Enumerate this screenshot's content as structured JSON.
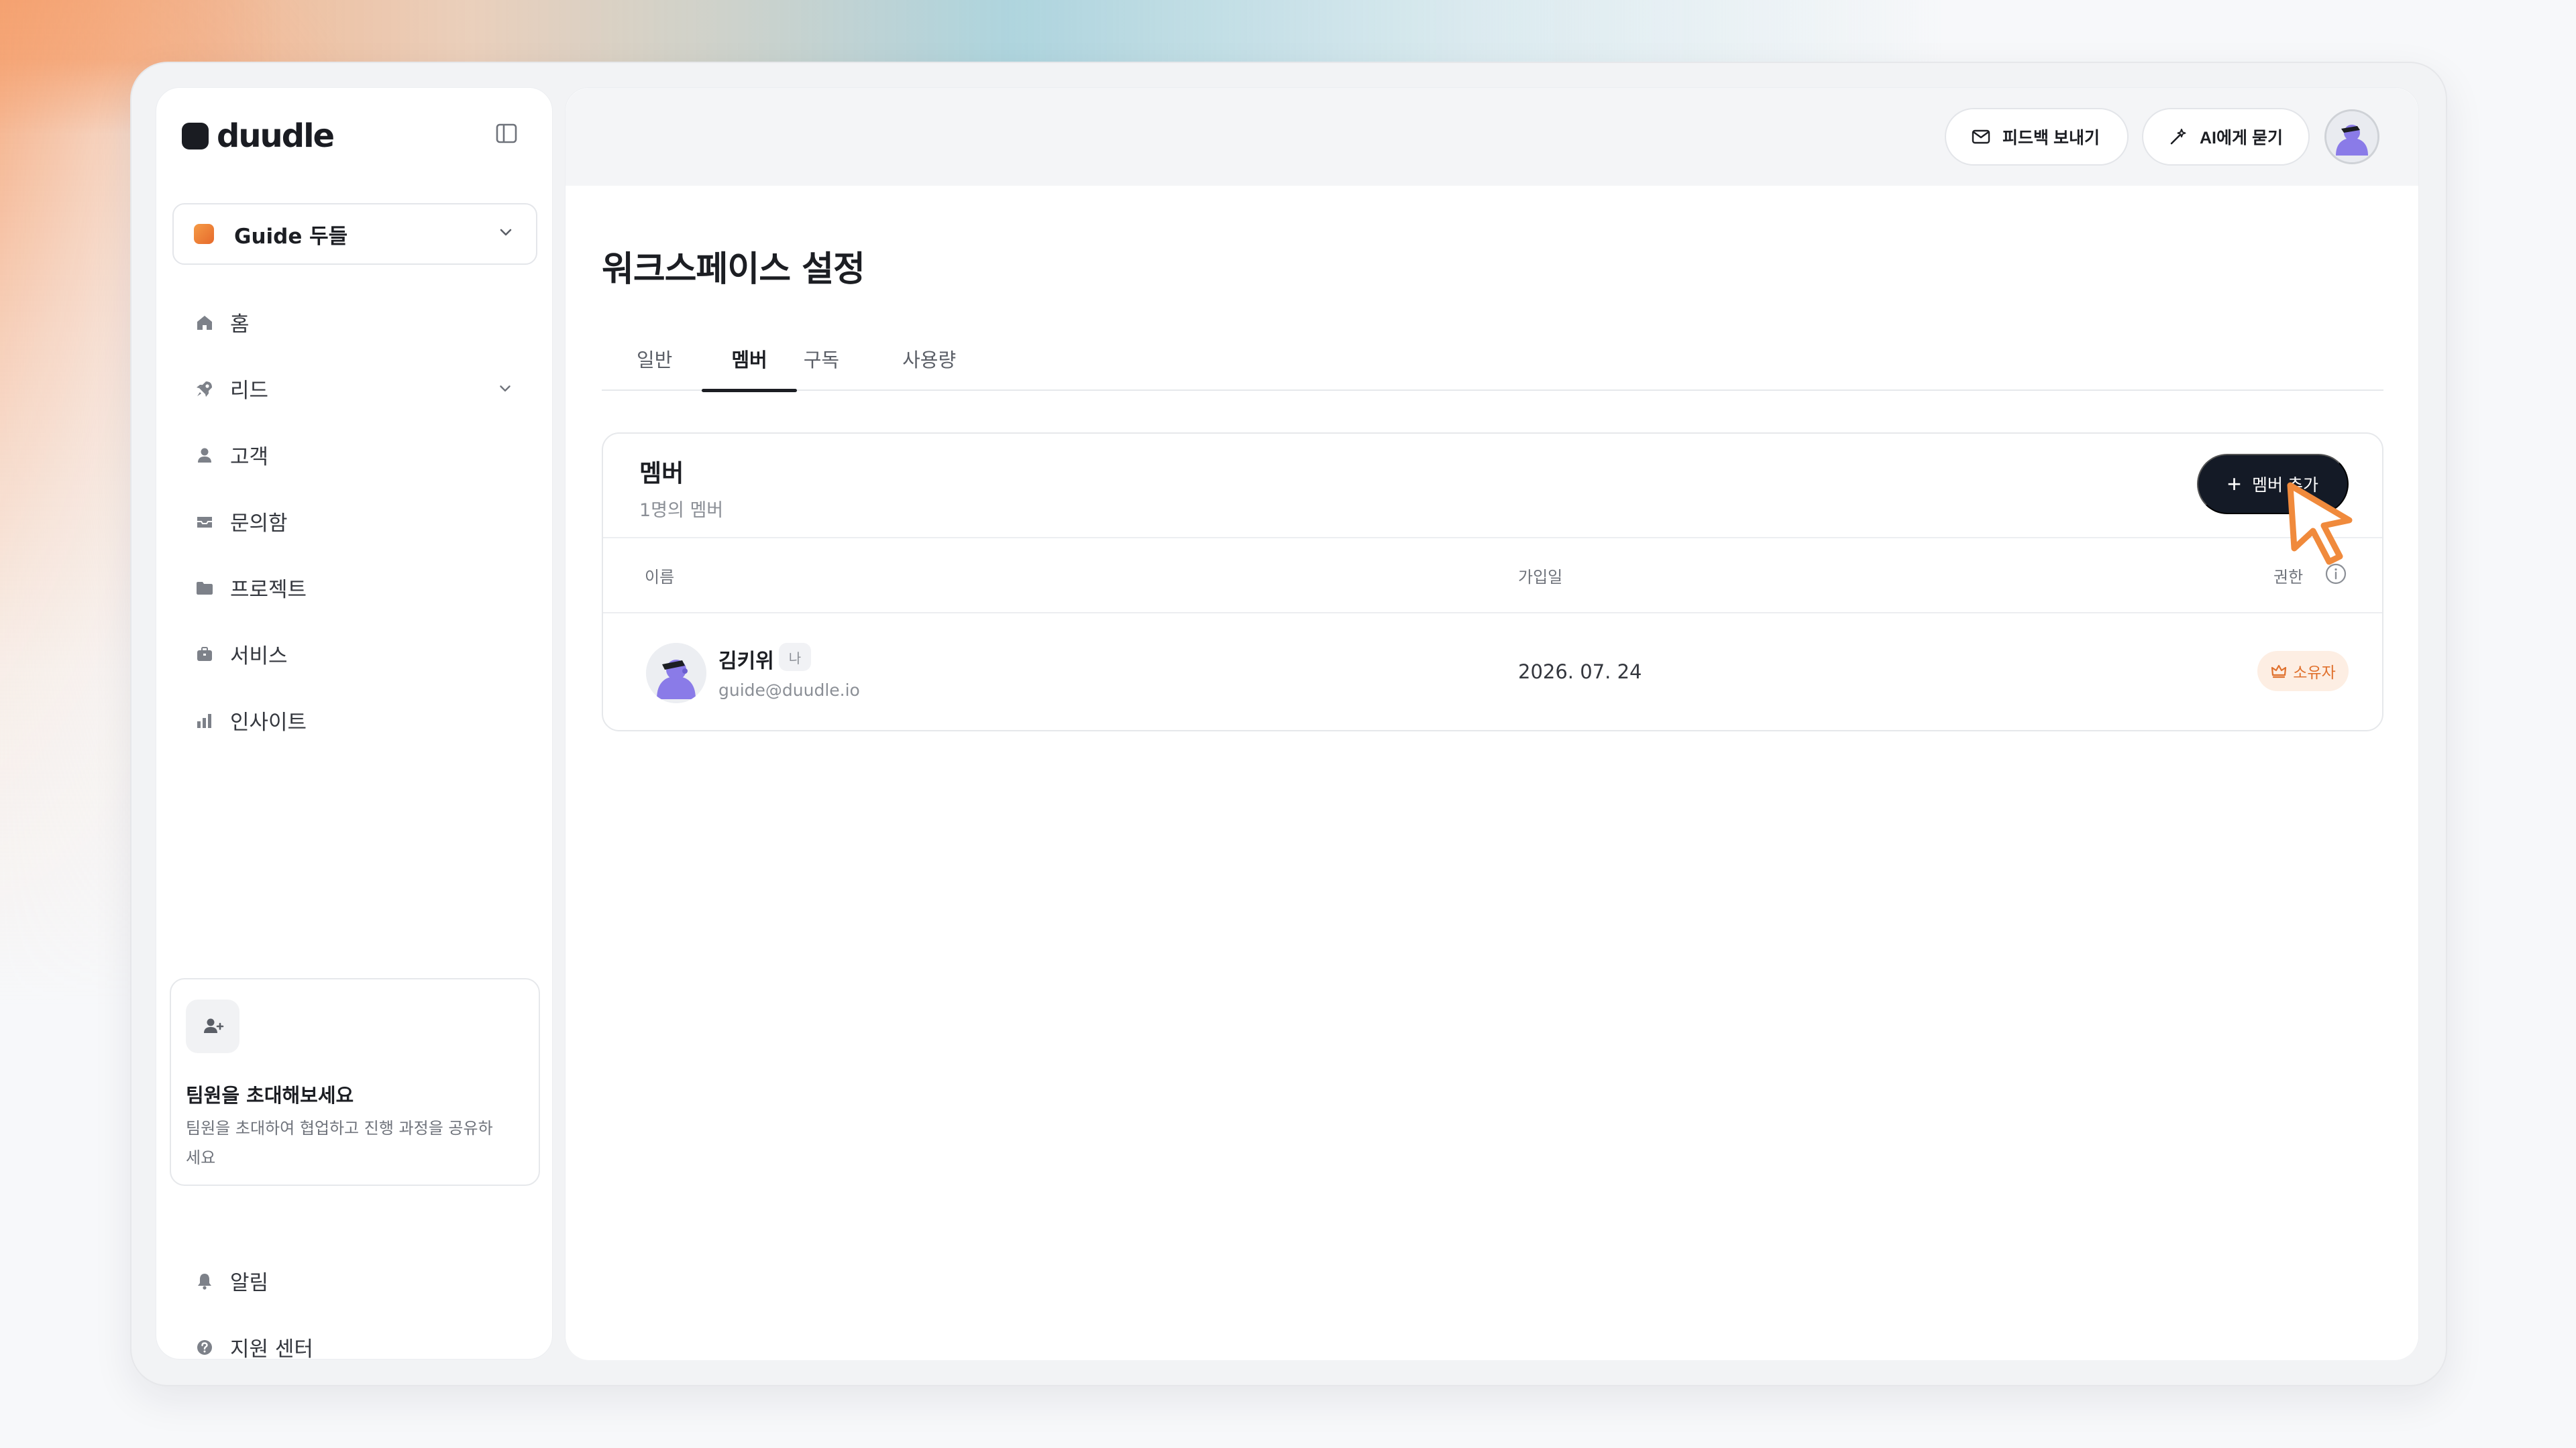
{
  "brand": {
    "name": "duudle"
  },
  "workspace": {
    "name": "Guide 두들"
  },
  "sidebar": {
    "items": [
      {
        "label": "홈",
        "icon": "home-icon"
      },
      {
        "label": "리드",
        "icon": "rocket-icon",
        "expandable": true
      },
      {
        "label": "고객",
        "icon": "user-icon"
      },
      {
        "label": "문의함",
        "icon": "inbox-icon"
      },
      {
        "label": "프로젝트",
        "icon": "folder-icon"
      },
      {
        "label": "서비스",
        "icon": "briefcase-icon"
      },
      {
        "label": "인사이트",
        "icon": "bar-chart-icon"
      }
    ],
    "invite": {
      "title": "팀원을 초대해보세요",
      "description": "팀원을 초대하여 협업하고 진행 과정을 공유하세요"
    },
    "bottom_items": [
      {
        "label": "알림",
        "icon": "bell-icon"
      },
      {
        "label": "지원 센터",
        "icon": "help-icon"
      }
    ]
  },
  "header": {
    "feedback_label": "피드백 보내기",
    "ai_label": "AI에게 묻기"
  },
  "page": {
    "title": "워크스페이스 설정",
    "tabs": [
      {
        "label": "일반",
        "active": false
      },
      {
        "label": "멤버",
        "active": true
      },
      {
        "label": "구독",
        "active": false
      },
      {
        "label": "사용량",
        "active": false
      }
    ]
  },
  "members": {
    "title": "멤버",
    "count_text": "1명의 멤버",
    "add_label": "멤버 추가",
    "columns": {
      "name": "이름",
      "joined": "가입일",
      "role": "권한"
    },
    "rows": [
      {
        "name": "김키위",
        "me_badge": "나",
        "email": "guide@duudle.io",
        "joined": "2026. 07. 24",
        "role": "소유자"
      }
    ]
  },
  "colors": {
    "accent_dark": "#141a26",
    "owner_badge_bg": "#fdeee3",
    "owner_badge_text": "#e0702c",
    "cursor": "#f08a3c",
    "avatar": "#8a7be8"
  }
}
